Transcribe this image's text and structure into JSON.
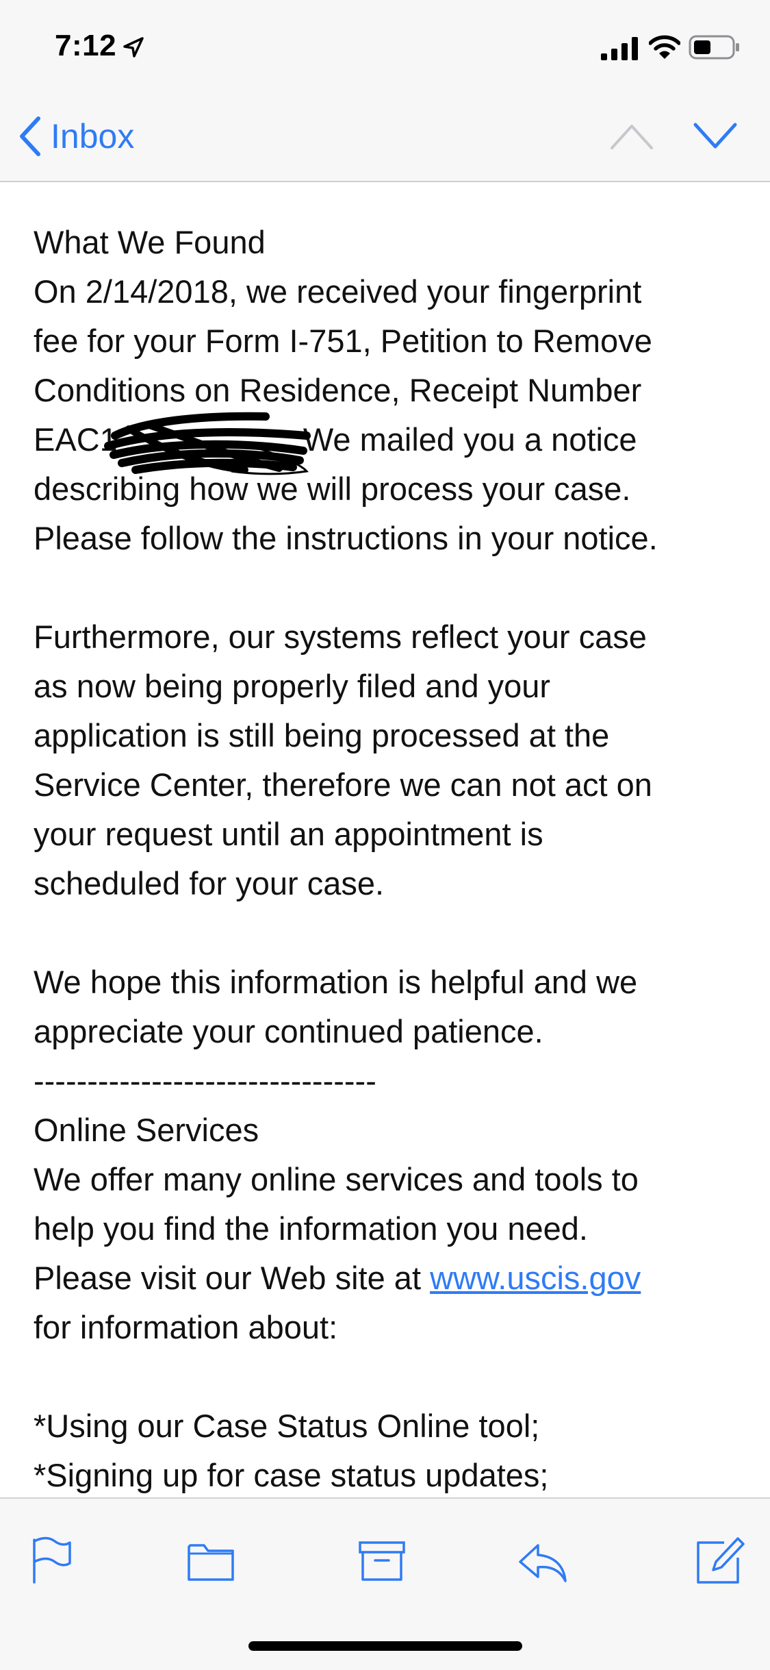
{
  "status_bar": {
    "time": "7:12"
  },
  "nav": {
    "back_label": "Inbox"
  },
  "colors": {
    "accent": "#2f7bf5",
    "bar_bg": "#f7f7f7",
    "disabled": "#c7c7cc"
  },
  "message": {
    "section_heading": "What We Found",
    "para1_lines": [
      "On 2/14/2018, we received your fingerprint",
      "fee for your Form I-751, Petition to Remove",
      "Conditions on Residence, Receipt Number",
      "EAC1",
      ". We mailed you a notice",
      "describing how we will process your case.",
      "Please follow the instructions in your notice."
    ],
    "para2_lines": [
      "Furthermore, our systems reflect your case",
      "as now being properly filed and your",
      "application is still being processed at the",
      "Service Center, therefore we can not act on",
      "your request until an appointment is",
      "scheduled for your case."
    ],
    "para3_lines": [
      "We hope this information is helpful and we",
      "appreciate your continued patience."
    ],
    "divider": "--------------------------------",
    "online_heading": "Online Services",
    "para4_lines": [
      "We offer many online services and tools to",
      "help you find the information you need.",
      "Please visit our Web site at ",
      "for information about:"
    ],
    "link_text": "www.uscis.gov",
    "bullets": [
      "*Using our Case Status Online tool;",
      "*Signing up for case status updates;"
    ]
  },
  "toolbar": {
    "icons": [
      "flag-icon",
      "folder-icon",
      "archive-icon",
      "reply-icon",
      "compose-icon"
    ]
  }
}
